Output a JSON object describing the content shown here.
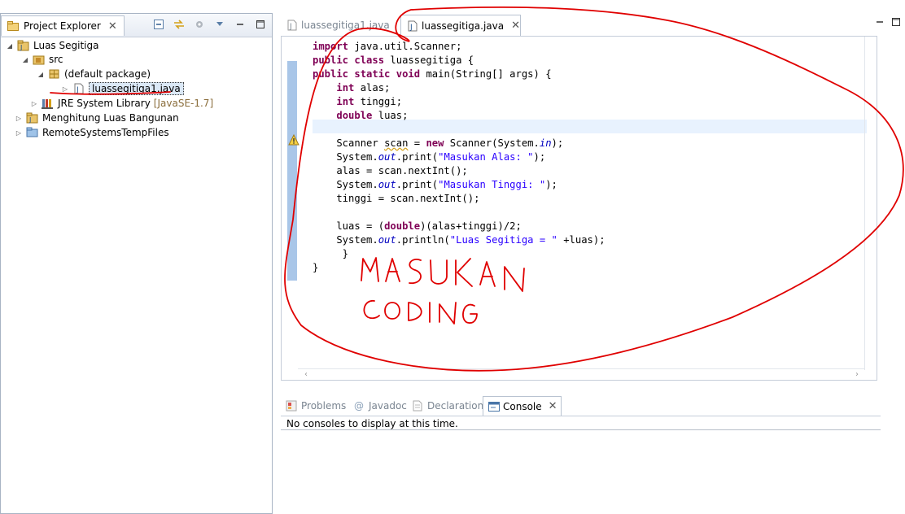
{
  "explorer": {
    "tab_label": "Project Explorer",
    "tree": [
      {
        "label": "Luas Segitiga",
        "suffix": ""
      },
      {
        "label": "src",
        "suffix": ""
      },
      {
        "label": "(default package)",
        "suffix": ""
      },
      {
        "label": "luassegitiga1.java",
        "suffix": ""
      },
      {
        "label": "JRE System Library",
        "suffix": "[JavaSE-1.7]"
      },
      {
        "label": "Menghitung Luas Bangunan",
        "suffix": ""
      },
      {
        "label": "RemoteSystemsTempFiles",
        "suffix": ""
      }
    ]
  },
  "editor": {
    "tabs": [
      {
        "label": "luassegitiga1.java",
        "active": false
      },
      {
        "label": "luassegitiga.java",
        "active": true
      }
    ],
    "code": [
      "import java.util.Scanner;",
      "public class luassegitiga {",
      "public static void main(String[] args) {",
      "    int alas;",
      "    int tinggi;",
      "    double luas;",
      "",
      "    Scanner scan = new Scanner(System.in);",
      "    System.out.print(\"Masukan Alas: \");",
      "    alas = scan.nextInt();",
      "    System.out.print(\"Masukan Tinggi: \");",
      "    tinggi = scan.nextInt();",
      "",
      "    luas = (double)(alas+tinggi)/2;",
      "    System.out.println(\"Luas Segitiga = \" +luas);",
      "     }",
      "}"
    ]
  },
  "console": {
    "tabs": [
      {
        "label": "Problems",
        "active": false
      },
      {
        "label": "Javadoc",
        "active": false
      },
      {
        "label": "Declaration",
        "active": false
      },
      {
        "label": "Console",
        "active": true
      }
    ],
    "message": "No consoles to display at this time."
  },
  "annotation": {
    "line1": "MASUKAN",
    "line2": "CODING",
    "color": "#e00000"
  }
}
